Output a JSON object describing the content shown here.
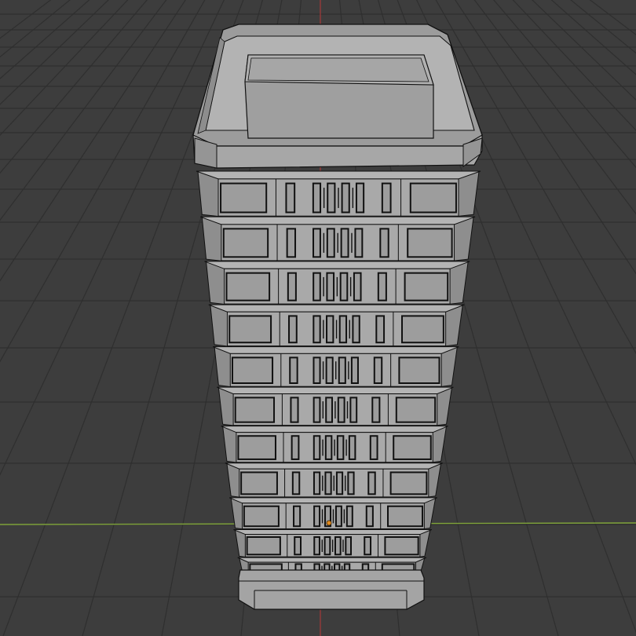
{
  "viewport": {
    "background": "#3d3d3d",
    "grid_line_color": "#2f2f2f",
    "x_axis_color": "#7fa33a",
    "y_axis_color": "#a53a3a"
  },
  "model": {
    "name": "building",
    "floor_count": 11,
    "body_color": "#a9a9a9",
    "side_color": "#8e8e8e",
    "roof_color": "#b3b3b3",
    "edge_color": "#111111",
    "window_color": "#9d9d9d",
    "origin_color": "#e08a1e"
  }
}
